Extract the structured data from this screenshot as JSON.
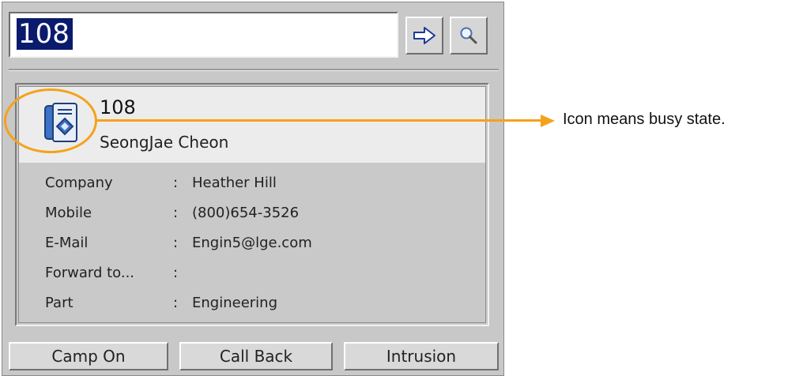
{
  "search": {
    "value": "108"
  },
  "toolbar": {
    "go_icon": "right-arrow-icon",
    "search_icon": "magnifier-icon"
  },
  "contact": {
    "icon": "phone-busy-icon",
    "extension": "108",
    "name": "SeongJae Cheon",
    "fields": [
      {
        "label": "Company",
        "value": "Heather Hill"
      },
      {
        "label": "Mobile",
        "value": "(800)654-3526"
      },
      {
        "label": "E-Mail",
        "value": "Engin5@lge.com"
      },
      {
        "label": "Forward to...",
        "value": ""
      },
      {
        "label": "Part",
        "value": "Engineering"
      }
    ],
    "separator": ":"
  },
  "actions": {
    "camp_on": "Camp On",
    "call_back": "Call Back",
    "intrusion": "Intrusion"
  },
  "annotation": {
    "text": "Icon means busy state.",
    "color": "#f5a21a"
  }
}
